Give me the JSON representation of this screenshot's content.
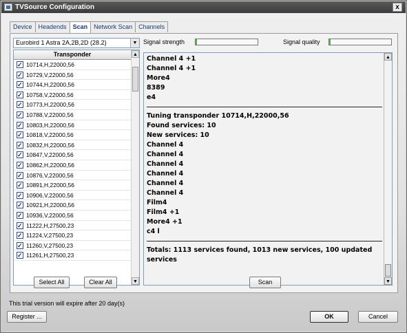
{
  "window": {
    "title": "TVSource Configuration",
    "close_glyph": "x"
  },
  "tabs": [
    {
      "label": "Device"
    },
    {
      "label": "Headends"
    },
    {
      "label": "Scan"
    },
    {
      "label": "Network Scan"
    },
    {
      "label": "Channels"
    }
  ],
  "scan": {
    "satellite": "Eurobird 1   Astra 2A,2B,2D (28.2)",
    "column_header": "Transponder",
    "transponders": [
      "10714,H,22000,56",
      "10729,V,22000,56",
      "10744,H,22000,56",
      "10758,V,22000,56",
      "10773,H,22000,56",
      "10788,V,22000,56",
      "10803,H,22000,56",
      "10818,V,22000,56",
      "10832,H,22000,56",
      "10847,V,22000,56",
      "10862,H,22000,56",
      "10876,V,22000,56",
      "10891,H,22000,56",
      "10906,V,22000,56",
      "10921,H,22000,56",
      "10936,V,22000,56",
      "11222,H,27500,23",
      "11224,V,27500,23",
      "11260,V,27500,23",
      "11261,H,27500,23"
    ],
    "signal_strength_label": "Signal strength",
    "signal_quality_label": "Signal quality",
    "signal_strength_fraction": 0.02,
    "signal_quality_fraction": 0.02,
    "log_top": [
      "Channel 4 +1",
      "Channel 4 +1",
      "More4",
      "8389",
      "e4"
    ],
    "log_middle": [
      "Tuning transponder 10714,H,22000,56",
      "Found services: 10",
      "New services: 10",
      "Channel 4",
      "Channel 4",
      "Channel 4",
      "Channel 4",
      "Channel 4",
      "Channel 4",
      "Film4",
      "Film4 +1",
      "More4 +1",
      "c4 l"
    ],
    "log_total": "Totals: 1113 services found, 1013 new services, 100 updated services",
    "select_all": "Select All",
    "clear_all": "Clear All",
    "scan_button": "Scan"
  },
  "footer": {
    "trial_text": "This trial version will expire after 20 day(s)",
    "register": "Register ...",
    "ok": "OK",
    "cancel": "Cancel"
  },
  "colors": {
    "meter_fill": "#59b04a",
    "tab_text": "#1a3b78"
  }
}
